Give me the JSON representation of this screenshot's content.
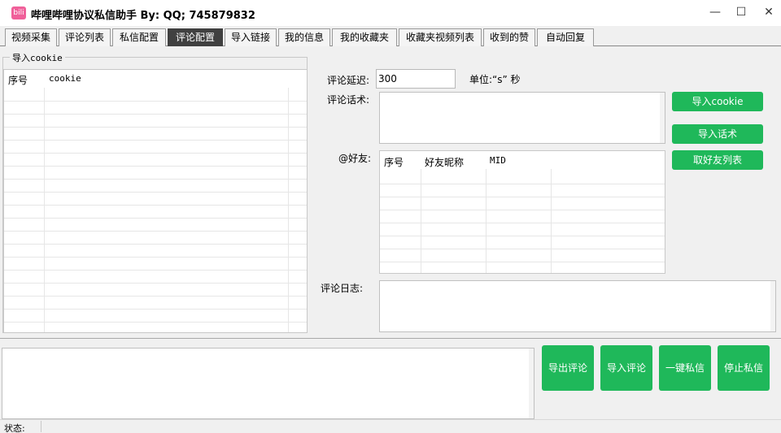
{
  "app": {
    "title": "哔哩哔哩协议私信助手 By:  QQ;  745879832",
    "icon_label": "bili"
  },
  "window_controls": {
    "minimize": "—",
    "maximize": "☐",
    "close": "✕"
  },
  "tabs": [
    {
      "label": "视频采集",
      "active": false
    },
    {
      "label": "评论列表",
      "active": false
    },
    {
      "label": "私信配置",
      "active": false
    },
    {
      "label": "评论配置",
      "active": true
    },
    {
      "label": "导入链接",
      "active": false
    },
    {
      "label": "我的信息",
      "active": false
    },
    {
      "label": "我的收藏夹",
      "active": false
    },
    {
      "label": "收藏夹视频列表",
      "active": false
    },
    {
      "label": "收到的赞",
      "active": false
    },
    {
      "label": "自动回复",
      "active": false
    }
  ],
  "cookie_group": {
    "title": "导入cookie",
    "columns": [
      "序号",
      "cookie"
    ]
  },
  "comment_config": {
    "delay_label": "评论延迟:",
    "delay_value": "300",
    "unit_label": "单位:“s” 秒",
    "script_label": "评论话术:",
    "friends_label": "@好友:",
    "friends_columns": [
      "序号",
      "好友昵称",
      "MID"
    ],
    "log_label": "评论日志:"
  },
  "buttons": {
    "import_cookie": "导入cookie",
    "import_script": "导入话术",
    "get_friends": "取好友列表",
    "export_comments": "导出评论",
    "import_comments": "导入评论",
    "one_click_dm": "一键私信",
    "stop_dm": "停止私信"
  },
  "status": {
    "label": "状态:"
  },
  "colors": {
    "accent_green": "#1fb85a",
    "active_tab": "#404040",
    "app_icon": "#f0609a"
  }
}
